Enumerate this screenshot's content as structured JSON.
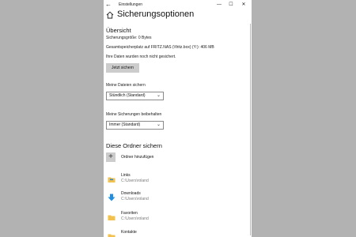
{
  "window": {
    "title": "Einstellungen",
    "controls": [
      "—",
      "☐",
      "✕"
    ]
  },
  "page": {
    "title": "Sicherungsoptionen"
  },
  "overview": {
    "heading": "Übersicht",
    "backup_size": "Sicherungsgröße: 0 Bytes",
    "total_space": "Gesamtspeicherplatz auf FRITZ.NAS (\\\\fritz.box) (Y:): 406 MB",
    "status": "Ihre Daten wurden noch nicht gesichert.",
    "backup_now_label": "Jetzt sichern"
  },
  "backup_my_files": {
    "label": "Meine Dateien sichern",
    "selected": "Stündlich (Standard)"
  },
  "keep_backups": {
    "label": "Meine Sicherungen beibehalten",
    "selected": "Immer (Standard)"
  },
  "folders": {
    "heading": "Diese Ordner sichern",
    "add_label": "Ordner hinzufügen",
    "items": [
      {
        "name": "Links",
        "path": "C:\\Users\\roland",
        "icon": "links-folder-icon"
      },
      {
        "name": "Downloads",
        "path": "C:\\Users\\roland",
        "icon": "downloads-folder-icon"
      },
      {
        "name": "Favoriten",
        "path": "C:\\Users\\roland",
        "icon": "favorites-folder-icon"
      },
      {
        "name": "Kontakte",
        "path": "",
        "icon": "contacts-folder-icon"
      }
    ]
  },
  "colors": {
    "accent": "#0078d7",
    "folder": "#f2c14e",
    "button_bg": "#cccccc"
  }
}
